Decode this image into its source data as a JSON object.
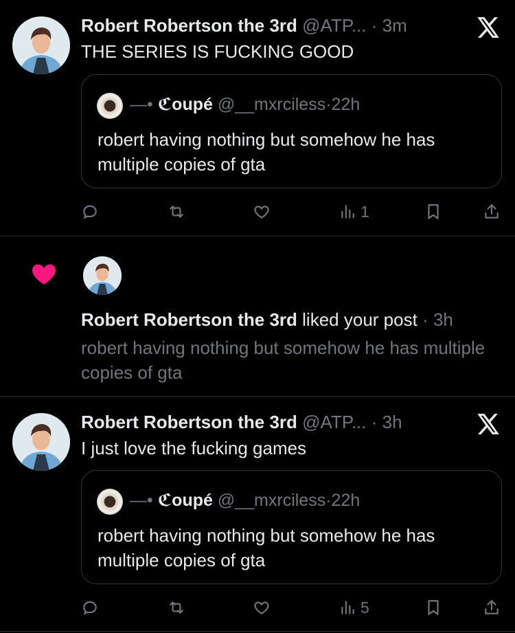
{
  "posts": [
    {
      "author_name": "Robert Robertson the 3rd",
      "author_handle": "@ATP...",
      "separator": "·",
      "time": "3m",
      "text": "THE SERIES IS FUCKING GOOD",
      "quote": {
        "prefix": "—•",
        "author_name": "ℭoupé",
        "author_handle": "@__mxrciless",
        "separator": "·",
        "time": "22h",
        "text": "robert having nothing but somehow he has multiple copies of gta"
      },
      "actions": {
        "reply_count": "",
        "repost_count": "",
        "like_count": "",
        "views_count": "1"
      }
    },
    {
      "author_name": "Robert Robertson the 3rd",
      "author_handle": "@ATP...",
      "separator": "·",
      "time": "3h",
      "text": "I just love the fucking games",
      "quote": {
        "prefix": "—•",
        "author_name": "ℭoupé",
        "author_handle": "@__mxrciless",
        "separator": "·",
        "time": "22h",
        "text": "robert having nothing but somehow he has multiple copies of gta"
      },
      "actions": {
        "reply_count": "",
        "repost_count": "",
        "like_count": "",
        "views_count": "5"
      }
    }
  ],
  "notification": {
    "actor_name": "Robert Robertson the 3rd",
    "verb": "liked your post",
    "separator": "·",
    "time": "3h",
    "text": "robert having nothing but somehow he has multiple copies of gta"
  },
  "icons": {
    "reply": "reply-icon",
    "repost": "repost-icon",
    "like": "like-icon",
    "views": "views-icon",
    "bookmark": "bookmark-icon",
    "share": "share-icon",
    "brand": "x-logo-icon",
    "notification_like": "heart-icon"
  },
  "colors": {
    "background": "#000000",
    "text_primary": "#e7e9ea",
    "text_secondary": "#71767b",
    "divider": "#2f3336",
    "like_pink": "#f91880"
  }
}
